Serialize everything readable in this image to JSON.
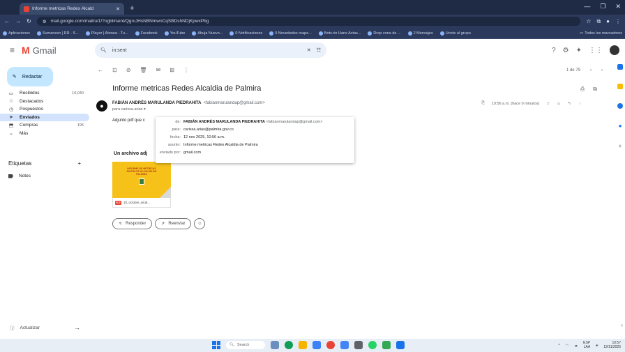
{
  "browser": {
    "tab_title": "Informe metricas Redes Alcald",
    "url": "mail.google.com/mail/u/1/?ogbl#sent/QgrcJHsNBNmwnCqSBDshNDjKpwxPbg",
    "bookmarks": [
      "Aplicaciones",
      "Sumanexo | RR - S...",
      "Player | Atenea - Tu...",
      "Facebook",
      "YouTube",
      "Abuja Nuevo...",
      "0 Notificaciones",
      "0 Novedades reape...",
      "Bots.rio Hans Actas...",
      "Drop zona de ...",
      "2 Mensajes",
      "Unete al grupo"
    ],
    "all_bookmarks": "Todos los marcadores"
  },
  "gmail": {
    "brand": "Gmail",
    "search_value": "in:sent",
    "compose_label": "Redactar",
    "nav": [
      {
        "icon": "inbox-icon",
        "glyph": "▭",
        "label": "Recibidos",
        "count": "10,040",
        "active": false
      },
      {
        "icon": "star-icon",
        "glyph": "☆",
        "label": "Destacados",
        "count": "",
        "active": false
      },
      {
        "icon": "clock-icon",
        "glyph": "◷",
        "label": "Pospuestos",
        "count": "",
        "active": false
      },
      {
        "icon": "send-icon",
        "glyph": "➤",
        "label": "Enviados",
        "count": "",
        "active": true
      },
      {
        "icon": "tag-icon",
        "glyph": "⬒",
        "label": "Compras",
        "count": "195",
        "active": false
      },
      {
        "icon": "chevron-down-icon",
        "glyph": "⌄",
        "label": "Más",
        "count": "",
        "active": false
      }
    ],
    "labels_title": "Etiquetas",
    "labels_add": "+",
    "label_items": [
      "Notes"
    ],
    "update_label": "Actualizar",
    "pager": "1 de 79"
  },
  "email": {
    "subject": "Informe metricas Redes Alcaldia de Palmira",
    "sender_name": "FABIÁN ANDRÉS MARULANDA PIEDRAHITA",
    "sender_email": "<fabianmarulandap@gmail.com>",
    "to_line": "para carissa.arias",
    "time": "10:56 a.m. (hace 0 minutos)",
    "body_start": "Adjunto pdf que c",
    "attachment_heading": "Un archivo adj",
    "attachment_thumb_title": "INFORME DE MÉTRICAS DIGITALES ALCALDÍA DE PALMIRA",
    "attachment_name": "10_octubre_alcal...",
    "reply_label": "Responder",
    "forward_label": "Reenviar"
  },
  "details_popup": {
    "rows": [
      {
        "key": "de:",
        "value": "FABIÁN ANDRÉS MARULANDA PIEDRAHITA",
        "extra": "<fabianmarulandap@gmail.com>"
      },
      {
        "key": "para:",
        "value": "carissa.arias@palmira.gov.co",
        "extra": ""
      },
      {
        "key": "fecha:",
        "value": "12 nov 2025, 10:56 a.m.",
        "extra": ""
      },
      {
        "key": "asunto:",
        "value": "Informe metricas Redes Alcaldia de Palmira",
        "extra": ""
      },
      {
        "key": "enviado por:",
        "value": "gmail.com",
        "extra": ""
      }
    ]
  },
  "taskbar": {
    "search_label": "Search",
    "lang": "ESP",
    "lang_sub": "LAA",
    "time": "10:57",
    "date": "12/11/2025"
  },
  "colors": {
    "compose_bg": "#c2e7ff",
    "active_nav": "#d3e3fd",
    "thumb_bg": "#f6c21a"
  }
}
